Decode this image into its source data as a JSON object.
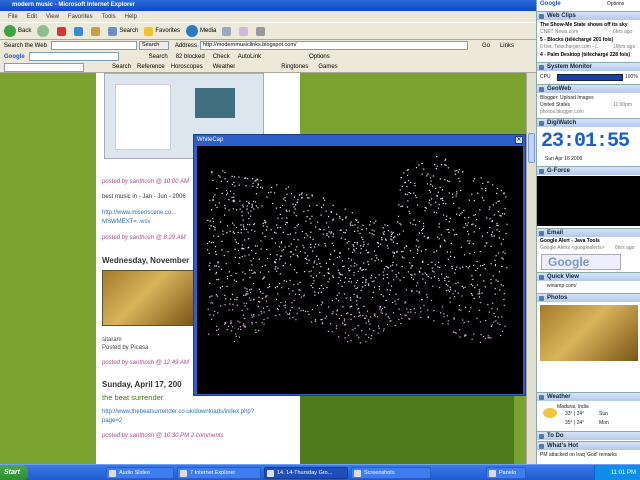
{
  "window": {
    "title": "modern music - Microsoft Internet Explorer"
  },
  "menu": [
    "File",
    "Edit",
    "View",
    "Favorites",
    "Tools",
    "Help"
  ],
  "toolbar": {
    "back": "Back",
    "search": "Search",
    "favorites": "Favorites",
    "media": "Media"
  },
  "searchbar": {
    "label": "Search the Web",
    "button": "Search",
    "address_label": "Address",
    "address": "http://modernmusiclinks.blogspot.com/",
    "go": "Go",
    "links": "Links"
  },
  "googlebar": {
    "logo": "Google",
    "search": "Search",
    "blocked": "82 blocked",
    "check": "Check",
    "autolink": "AutoLink",
    "options": "Options"
  },
  "linkbar": {
    "search": "Search",
    "reference": "Reference",
    "horoscopes": "Horoscopes",
    "weather": "Weather",
    "ringtones": "Ringtones",
    "games": "Games"
  },
  "blog": {
    "posted1": "posted by santhosh @ 10:00 AM",
    "best_music": "best music in - Jan - Jun - 2006",
    "link1": "http://www.misenscene.co...",
    "link1b": "MSWMEXT=..wsv",
    "posted2": "posted by santhosh @ 8:29 AM",
    "date1": "Wednesday, November",
    "caption1": "sitaram",
    "caption2": "Posted by Picasa",
    "posted3": "posted by santhosh @ 12:49 AM",
    "date2": "Sunday, April 17, 200",
    "title": "the beat surrender",
    "link2": "http://www.thebeatsurrender.co.uk/downloads/index.php?",
    "link2b": "page=2",
    "posted4": "posted by santhosh @ 10:30 PM 2 comments"
  },
  "whitecap": {
    "title": "WhiteCap",
    "close": "✕"
  },
  "sidebar": {
    "search_logo": "Google",
    "options": "Options",
    "webclips": {
      "title": "Web Clips",
      "items": [
        {
          "text": "The Show-Me State shows off its sky",
          "time": "6hrs ago"
        },
        {
          "text": "CNET News.com",
          "time": ""
        },
        {
          "text": "5 - Blocks (téléchargé 201 fois)",
          "time": ""
        },
        {
          "text": "0 tret. Telecharger.com - L",
          "time": "16hrs ago"
        },
        {
          "text": "4 - Palm Desktop (téléchargé 228 fois)",
          "time": ""
        }
      ]
    },
    "sysmon": {
      "title": "System Monitor",
      "cpu_label": "CPU",
      "cpu_value": "100%",
      "mem_label": "",
      "mem_value": ""
    },
    "geoweb": {
      "title": "GeoWeb",
      "l1": "Blogger: Upload Images",
      "l2": "United States",
      "time": "11:00pm",
      "l3": "photos.blogger.com"
    },
    "digiwatch": {
      "title": "DigiWatch",
      "time": "23:01:55",
      "date": "Sun Apr 16 2006"
    },
    "gforce": {
      "title": "G-Force"
    },
    "email": {
      "title": "Email",
      "l1": "Google Alert - Java Tools",
      "l2": "Google Alerts <googlealerts>",
      "time": "6hrs ago"
    },
    "google_box": "Google",
    "quickview": {
      "title": "Quick View",
      "url": "winamp.com/"
    },
    "photos": {
      "title": "Photos"
    },
    "weather": {
      "title": "Weather",
      "city": "Madurai, India",
      "t1": "33° | 24°",
      "d1": "Sun",
      "t2": "35° | 24°",
      "d2": "Mon"
    },
    "todo": {
      "title": "To Do"
    },
    "whatshot": {
      "title": "What's Hot",
      "l1": "PM attacked on Iraq 'God' remarks"
    }
  },
  "taskbar": {
    "start": "Start",
    "tasks": [
      "Audio Slideo",
      "7 Internet Explorer",
      "14. 14-Thursday Gro...",
      "Screenshots",
      "Panelo"
    ],
    "clock": "11:01 PM"
  }
}
